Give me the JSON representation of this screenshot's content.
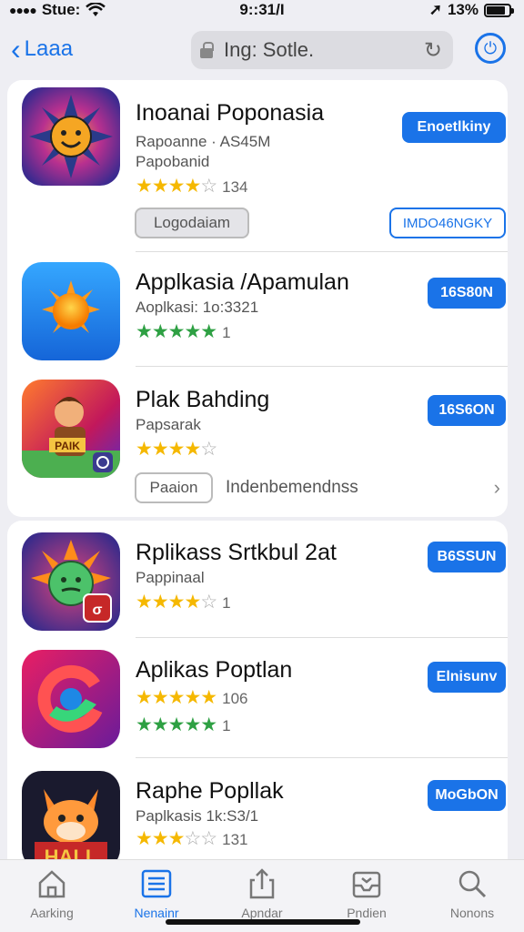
{
  "status": {
    "carrier": "Stue:",
    "time": "9::31/I",
    "battery": "13%",
    "battery_level": 0.85
  },
  "navbar": {
    "back_label": "Laaa",
    "url_text": "Ing: Sotle.",
    "reload_icon": "reload-icon",
    "action_icon": "power-icon"
  },
  "card1": {
    "apps": [
      {
        "title": "Inoanai Poponasia",
        "sub1": "Rapoanne · AS45M",
        "sub2": "Papobanid",
        "stars_full": 4,
        "stars_total": 5,
        "count": "134",
        "button": "Enoetlkiny",
        "secondary_button": "Logodaiam",
        "secondary_outline": "IMDO46NGKY",
        "icon": "sun-face-icon"
      },
      {
        "title": "Applkasia /Apamulan",
        "sub1": "Aoplkasi: 1o:3321",
        "stars_full": 5,
        "stars_total": 5,
        "count": "1",
        "button": "16S80N",
        "icon": "sun-icon"
      },
      {
        "title": "Plak Bahding",
        "sub1": "Papsarak",
        "stars_full": 4,
        "stars_total": 5,
        "count": "",
        "button": "16S6ON",
        "icon": "game-hero-icon",
        "pill_button": "Paaion",
        "link_text": "Indenbemendnss"
      }
    ]
  },
  "card2": {
    "apps": [
      {
        "title": "Rplikass Srtkbul 2at",
        "sub1": "Pappinaal",
        "stars_full": 4,
        "stars_total": 5,
        "count": "1",
        "button": "B6SSUN",
        "icon": "green-face-icon"
      },
      {
        "title": "Aplikas Poptlan",
        "stars_full": 5,
        "stars_total": 5,
        "count": "106",
        "stars2_full": 5,
        "count2": "1",
        "button": "Elnisunv",
        "icon": "swirl-icon"
      },
      {
        "title": "Raphe Popllak",
        "sub1": "Paplkasis 1k:S3/1",
        "stars_full": 3,
        "stars_total": 5,
        "count": "131",
        "button": "MoGbON",
        "icon": "fox-icon"
      }
    ]
  },
  "tabs": [
    {
      "label": "Aarking",
      "icon": "home-icon"
    },
    {
      "label": "Nenainr",
      "icon": "list-icon",
      "active": true
    },
    {
      "label": "Apndar",
      "icon": "share-icon"
    },
    {
      "label": "Pndien",
      "icon": "inbox-icon"
    },
    {
      "label": "Nonons",
      "icon": "search-icon"
    }
  ]
}
